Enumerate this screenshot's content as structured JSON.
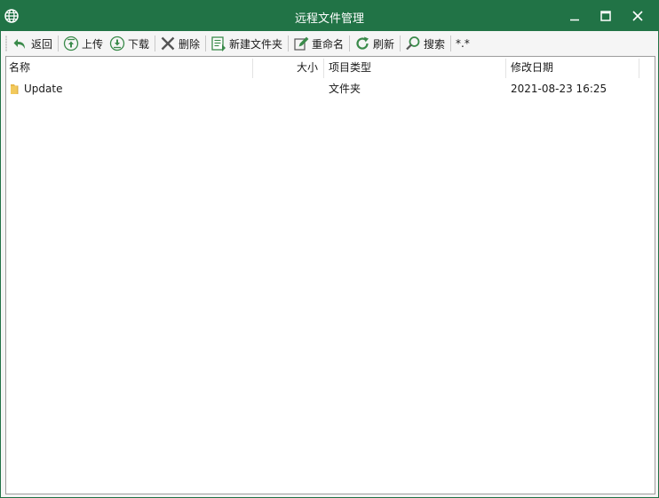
{
  "window": {
    "title": "远程文件管理",
    "colors": {
      "titlebar": "#217346",
      "folder": "#e8b84a",
      "icon_green": "#3a8a4a"
    }
  },
  "toolbar": {
    "back_label": "返回",
    "upload_label": "上传",
    "download_label": "下载",
    "delete_label": "删除",
    "new_folder_label": "新建文件夹",
    "rename_label": "重命名",
    "refresh_label": "刷新",
    "search_label": "搜索",
    "filter_text": "*.*"
  },
  "list": {
    "columns": {
      "name": "名称",
      "size": "大小",
      "type": "项目类型",
      "modified": "修改日期"
    },
    "rows": [
      {
        "icon": "folder-icon",
        "name": "Update",
        "size": "",
        "type": "文件夹",
        "modified": "2021-08-23 16:25"
      }
    ]
  }
}
